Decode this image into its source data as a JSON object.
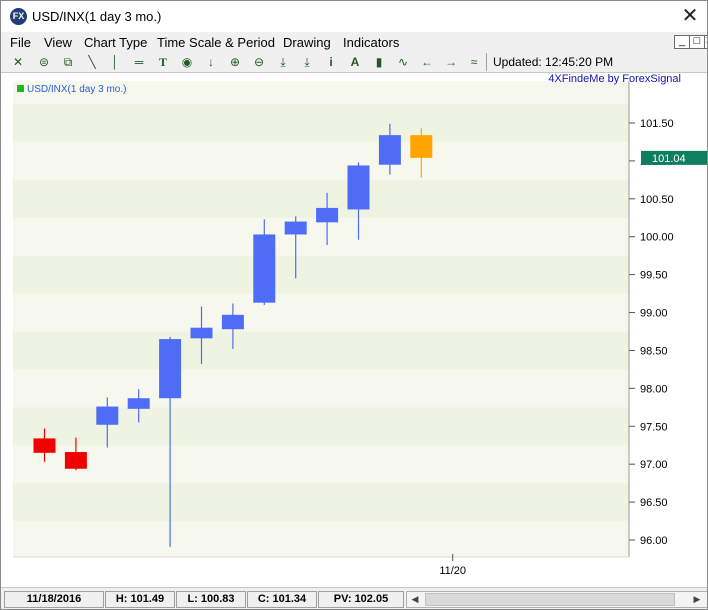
{
  "window": {
    "title": "USD/INX(1 day  3 mo.)",
    "app_icon_text": "FX",
    "close_label": "✕"
  },
  "menu": {
    "items": [
      "File",
      "View",
      "Chart Type",
      "Time Scale & Period",
      "Drawing",
      "Indicators"
    ],
    "mdi_buttons": [
      "_",
      "□",
      "✕"
    ]
  },
  "toolbar": {
    "icons": [
      "candle-icon",
      "print-icon",
      "copy-icon",
      "trendline-icon",
      "vertical-line-icon",
      "horizontal-line-icon",
      "text-icon",
      "target-icon",
      "down-arrow-icon",
      "zoom-in-icon",
      "zoom-out-icon",
      "fit-icon",
      "download-icon",
      "info-icon",
      "font-icon",
      "bar-chart-icon",
      "line-chart-icon",
      "scroll-left-icon",
      "scroll-right-icon",
      "settings-icon"
    ],
    "glyphs": [
      "✕",
      "⊜",
      "⧉",
      "╲",
      "│",
      "═",
      "T",
      "◉",
      "↓",
      "⊕",
      "⊖",
      "⤓",
      "⤓",
      "i",
      "A",
      "▮",
      "∿",
      "←",
      "→",
      "≈"
    ],
    "updated": "Updated: 12:45:20 PM"
  },
  "chart_data": {
    "type": "candlestick",
    "title": "USD/INX(1 day  3 mo.)",
    "watermark": "4XFindeMe by ForexSignal",
    "current_price_label": "101.04",
    "ylim": [
      95.9,
      101.63
    ],
    "yticks": [
      "96.00",
      "96.50",
      "97.00",
      "97.50",
      "98.00",
      "98.50",
      "99.00",
      "99.50",
      "100.00",
      "100.50",
      "101.00",
      "101.50"
    ],
    "xtick": {
      "index": 13,
      "label": "11/20"
    },
    "colors": {
      "up": "#4f6cf5",
      "down": "#f00000",
      "current": "#ffa500",
      "band_a": "#f6f8ee",
      "band_b": "#eff3e2",
      "price_tag": "#0e7f5e"
    },
    "candles": [
      {
        "o": 97.34,
        "h": 97.47,
        "l": 97.03,
        "c": 97.15,
        "color": "down"
      },
      {
        "o": 97.16,
        "h": 97.35,
        "l": 96.92,
        "c": 96.94,
        "color": "down"
      },
      {
        "o": 97.52,
        "h": 97.88,
        "l": 97.22,
        "c": 97.76,
        "color": "up"
      },
      {
        "o": 97.73,
        "h": 97.99,
        "l": 97.55,
        "c": 97.87,
        "color": "up"
      },
      {
        "o": 97.87,
        "h": 98.68,
        "l": 95.91,
        "c": 98.65,
        "color": "up"
      },
      {
        "o": 98.66,
        "h": 99.08,
        "l": 98.32,
        "c": 98.8,
        "color": "up"
      },
      {
        "o": 98.78,
        "h": 99.12,
        "l": 98.52,
        "c": 98.97,
        "color": "up"
      },
      {
        "o": 99.13,
        "h": 100.23,
        "l": 99.1,
        "c": 100.03,
        "color": "up"
      },
      {
        "o": 100.03,
        "h": 100.27,
        "l": 99.45,
        "c": 100.2,
        "color": "up"
      },
      {
        "o": 100.19,
        "h": 100.58,
        "l": 99.89,
        "c": 100.38,
        "color": "up"
      },
      {
        "o": 100.36,
        "h": 100.98,
        "l": 99.96,
        "c": 100.94,
        "color": "up"
      },
      {
        "o": 100.95,
        "h": 101.49,
        "l": 100.82,
        "c": 101.34,
        "color": "up"
      },
      {
        "o": 101.34,
        "h": 101.43,
        "l": 100.78,
        "c": 101.04,
        "color": "current"
      }
    ]
  },
  "status": {
    "date": "11/18/2016",
    "high": "H: 101.49",
    "low": "L: 100.83",
    "close": "C: 101.34",
    "pv": "PV: 102.05",
    "left_arrow": "◀",
    "right_arrow": "▶"
  }
}
